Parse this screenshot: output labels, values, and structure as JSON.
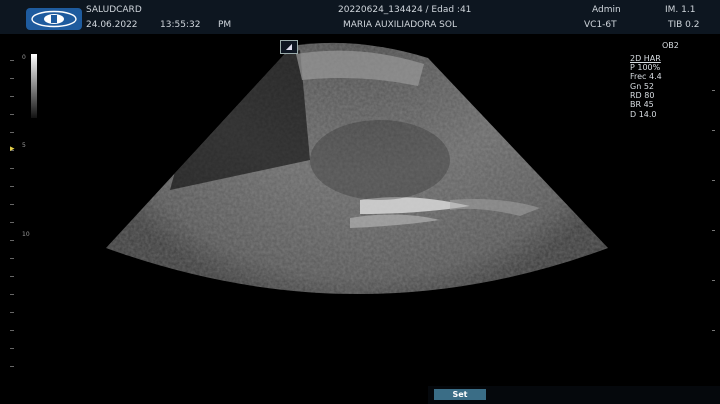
{
  "header": {
    "clinic": "SALUDCARD",
    "date": "24.06.2022",
    "time": "13:55:32",
    "ampm": "PM",
    "study_id": "20220624_134424 / Edad :41",
    "patient": "MARIA AUXILIADORA SOL",
    "user": "Admin",
    "im": "IM. 1.1",
    "probe": "VC1-6T",
    "tib": "TIB 0.2"
  },
  "params": {
    "preset": "OB2",
    "mode": "2D HAR",
    "power": "P 100%",
    "freq": "Frec 4.4",
    "gain": "Gn 52",
    "rd": "RD 80",
    "br": "BR 45",
    "depth": "D 14.0"
  },
  "depth_marks": {
    "top": "0",
    "mid": "5",
    "deep": "10"
  },
  "controls": {
    "set_label": "Set"
  },
  "colors": {
    "header_bg": "#0d1620",
    "logo": "#1e5b9e",
    "marker": "#e6d24a",
    "button": "#3a6d86"
  },
  "icons": {
    "logo": "saludcard-logo-icon",
    "probe": "probe-orientation-icon",
    "focus": "focus-marker-icon"
  }
}
